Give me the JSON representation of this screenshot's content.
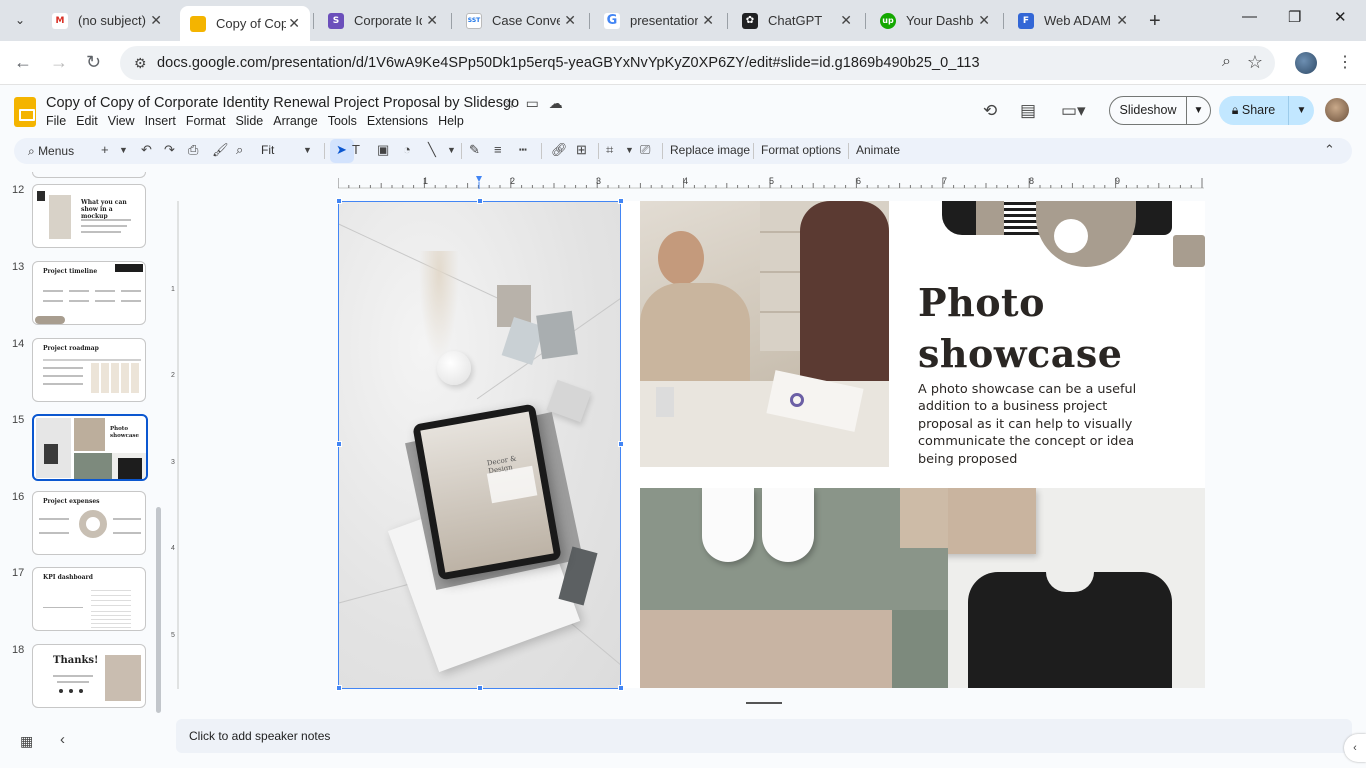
{
  "browser": {
    "tabs": [
      {
        "title": "(no subject)",
        "favicon": "gmail-icon",
        "color": "#d93025",
        "glyph": "M"
      },
      {
        "title": "Copy of Copy of Corporate Identity Renewal Project Proposal by Slidesgo",
        "favicon": "slides-icon",
        "color": "#f4b400",
        "glyph": "",
        "active": true
      },
      {
        "title": "Corporate Identity",
        "favicon": "slidesgo-icon",
        "color": "#6b4fbb",
        "glyph": "S"
      },
      {
        "title": "Case Converter",
        "favicon": "sst-icon",
        "color": "#ffffff",
        "glyph": "SST"
      },
      {
        "title": "presentation",
        "favicon": "google-icon",
        "color": "#4285f4",
        "glyph": "G"
      },
      {
        "title": "ChatGPT",
        "favicon": "chatgpt-icon",
        "color": "#202123",
        "glyph": "✿"
      },
      {
        "title": "Your Dashboard",
        "favicon": "upwork-icon",
        "color": "#14a800",
        "glyph": "up"
      },
      {
        "title": "Web ADAMI",
        "favicon": "forms-icon",
        "color": "#3367d6",
        "glyph": "F"
      }
    ],
    "url": "docs.google.com/presentation/d/1V6wA9Ke4SPp50Dk1p5erq5-yeaGBYxNvYpKyZ0XP6ZY/edit#slide=id.g1869b490b25_0_113"
  },
  "doc": {
    "title": "Copy of Copy of Corporate Identity Renewal Project Proposal by Slidesgo",
    "menu": [
      "File",
      "Edit",
      "View",
      "Insert",
      "Format",
      "Slide",
      "Arrange",
      "Tools",
      "Extensions",
      "Help"
    ],
    "slideshow_label": "Slideshow",
    "share_label": "Share"
  },
  "edit_toolbar": {
    "search_label": "Menus",
    "zoom_value": "Fit",
    "replace_image": "Replace image",
    "format_options": "Format options",
    "animate": "Animate"
  },
  "filmstrip": {
    "slides": [
      {
        "number": "12",
        "title": "What you can show in a mockup"
      },
      {
        "number": "13",
        "title": "Project timeline"
      },
      {
        "number": "14",
        "title": "Project roadmap"
      },
      {
        "number": "15",
        "title": "Photo showcase",
        "selected": true
      },
      {
        "number": "16",
        "title": "Project expenses"
      },
      {
        "number": "17",
        "title": "KPI dashboard"
      },
      {
        "number": "18",
        "title": "Thanks!"
      }
    ]
  },
  "ruler": {
    "top_ticks": [
      "1",
      "2",
      "3",
      "4",
      "5",
      "6",
      "7",
      "8",
      "9"
    ],
    "left_ticks": [
      "1",
      "2",
      "3",
      "4",
      "5"
    ]
  },
  "slide": {
    "title_line1": "Photo",
    "title_line2": "showcase",
    "body": "A photo showcase can be a useful addition to a business project proposal as it can help to visually communicate the concept or idea being proposed",
    "tablet_title": "Decor & Design",
    "colors": {
      "text": "#2a2623",
      "taupe": "#a89d8f",
      "black": "#1d1d1d",
      "sage": "#7d8a7d"
    }
  },
  "notes": {
    "placeholder": "Click to add speaker notes"
  }
}
